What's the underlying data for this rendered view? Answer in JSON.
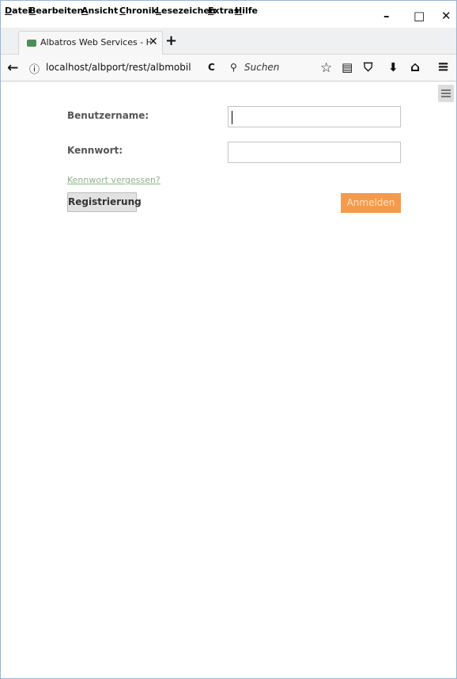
{
  "menubar": {
    "items": [
      "Datei",
      "Bearbeiten",
      "Ansicht",
      "Chronik",
      "Lesezeichen",
      "Extras",
      "Hilfe"
    ],
    "window_buttons": [
      "–",
      "□",
      "✕"
    ]
  },
  "tab": {
    "title": "Albatros Web Services - Her",
    "close": "✕",
    "new_tab": "+"
  },
  "navbar": {
    "back": "←",
    "info": "ⓘ",
    "url": "localhost/albport/rest/albmobil",
    "reload": "C",
    "search_icon": "⚲",
    "search_placeholder": "Suchen",
    "toolbar_icons": [
      "star-icon",
      "clipboard-icon",
      "pocket-icon",
      "download-icon",
      "home-icon",
      "menu-icon"
    ],
    "toolbar_glyphs": [
      "☆",
      "▤",
      "⛉",
      "⬇",
      "⌂",
      "≡"
    ]
  },
  "login": {
    "username_label": "Benutzername:",
    "password_label": "Kennwort:",
    "forgot_link": "Kennwort vergessen?",
    "register_button": "Registrierung",
    "login_button": "Anmelden",
    "username_value": "",
    "password_value": ""
  },
  "colors": {
    "login_button": "#f59a4a",
    "forgot_link": "#8fb08a",
    "favicon": "#4c8f55"
  }
}
